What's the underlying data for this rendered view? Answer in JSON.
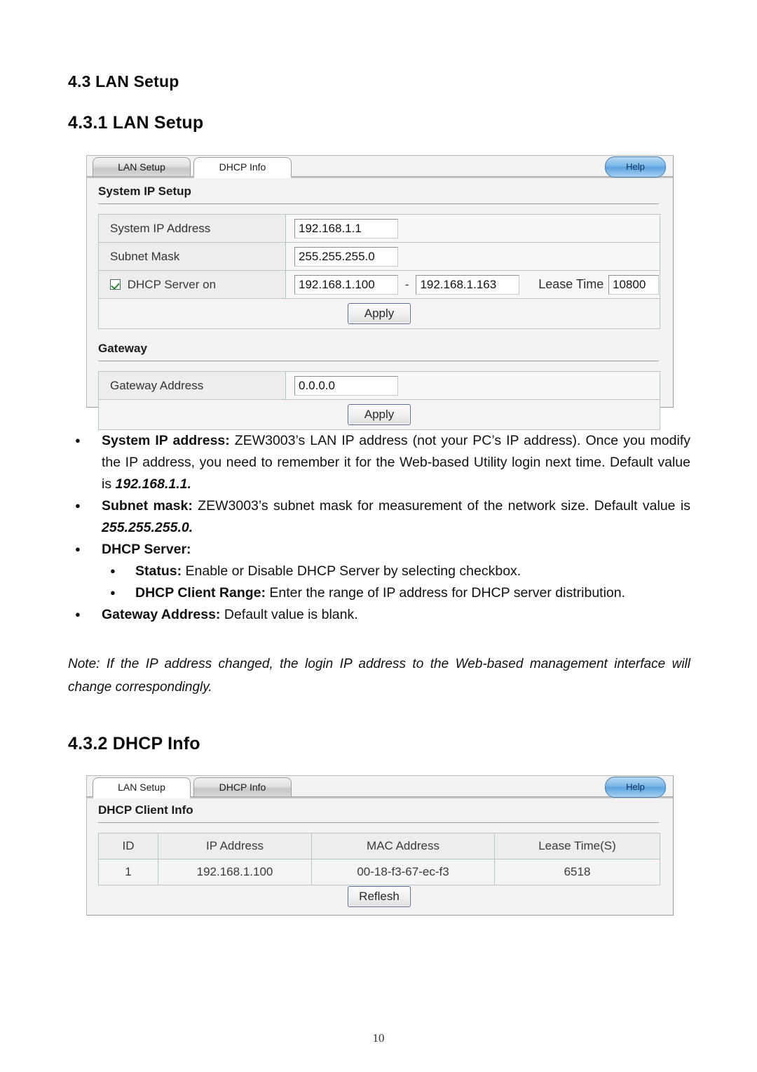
{
  "document": {
    "page_number": "10",
    "headings": {
      "section_43": "4.3 LAN Setup",
      "section_431": "4.3.1 LAN Setup",
      "section_432": "4.3.2 DHCP Info"
    }
  },
  "lan_setup_panel": {
    "tabs": [
      {
        "label": "LAN Setup",
        "active": false
      },
      {
        "label": "DHCP Info",
        "active": true
      }
    ],
    "help_label": "Help",
    "groups": {
      "system_ip_setup": {
        "title": "System IP Setup",
        "rows": [
          {
            "label": "System IP Address",
            "value": "192.168.1.1"
          },
          {
            "label": "Subnet Mask",
            "value": "255.255.255.0"
          }
        ],
        "dhcp_row": {
          "checkbox_label": "DHCP Server on",
          "checked": true,
          "range_start": "192.168.1.100",
          "range_separator": "-",
          "range_end": "192.168.1.163",
          "lease_time_label": "Lease Time",
          "lease_time_value": "10800"
        },
        "apply_label": "Apply"
      },
      "gateway": {
        "title": "Gateway",
        "rows": [
          {
            "label": "Gateway Address",
            "value": "0.0.0.0"
          }
        ],
        "apply_label": "Apply"
      }
    }
  },
  "dhcp_info_panel": {
    "tabs": [
      {
        "label": "LAN Setup",
        "active": true
      },
      {
        "label": "DHCP Info",
        "active": false
      }
    ],
    "help_label": "Help",
    "group_title": "DHCP Client Info",
    "table": {
      "columns": [
        "ID",
        "IP Address",
        "MAC Address",
        "Lease Time(S)"
      ],
      "rows": [
        [
          "1",
          "192.168.1.100",
          "00-18-f3-67-ec-f3",
          "6518"
        ]
      ]
    },
    "refresh_label": "Reflesh"
  },
  "body": {
    "bullet_system_ip_label": "System IP address:",
    "bullet_system_ip_text_a": " ZEW3003’s LAN IP address (not your PC’s IP address). Once you modify the IP address, you need to remember it for the Web-based Utility login next time. Default value is ",
    "bullet_system_ip_value": "192.168.1.1.",
    "bullet_subnet_label": "Subnet mask:",
    "bullet_subnet_text_a": " ZEW3003’s subnet mask for measurement of the network size. Default value is ",
    "bullet_subnet_value": "255.255.255.0.",
    "bullet_dhcp_server_label": "DHCP Server:",
    "bullet_status_label": "Status:",
    "bullet_status_text": " Enable or Disable DHCP Server by selecting checkbox.",
    "bullet_client_range_label": "DHCP Client Range:",
    "bullet_client_range_text": " Enter the range of IP address for DHCP server distribution.",
    "bullet_gateway_label": "Gateway Address:",
    "bullet_gateway_text": " Default value is blank.",
    "note_text": "Note: If the IP address changed, the login IP address to the Web-based management interface will change correspondingly."
  },
  "colors": {
    "panel_bg": "#f2f2f2",
    "help_blue": "#5aa3e0",
    "check_green": "#1f8a2e",
    "table_border": "#b4c8c4"
  }
}
